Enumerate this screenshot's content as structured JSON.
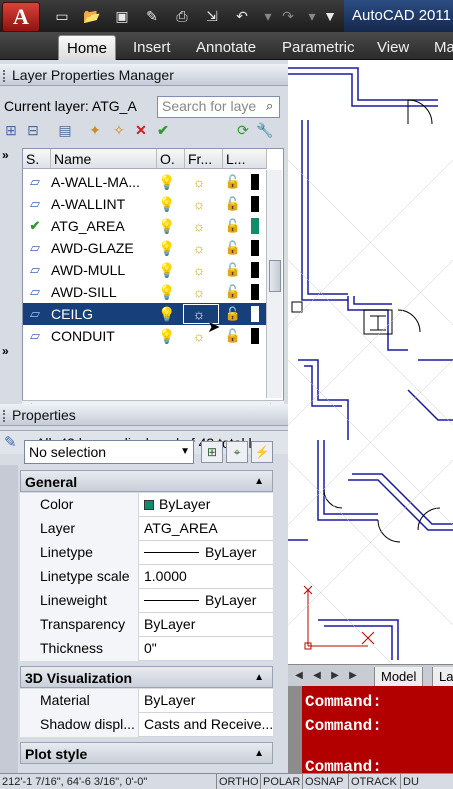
{
  "app": {
    "title": "AutoCAD 2011",
    "logo_letter": "A",
    "quick_access_icons": [
      "new-icon",
      "open-icon",
      "save-icon",
      "saveas-icon",
      "print-icon",
      "publish-icon",
      "undo-icon",
      "redo-icon",
      "dropdown-icon"
    ]
  },
  "ribbon": {
    "tabs": [
      {
        "label": "Home",
        "active": true
      },
      {
        "label": "Insert"
      },
      {
        "label": "Annotate"
      },
      {
        "label": "Parametric"
      },
      {
        "label": "View"
      },
      {
        "label": "Ma"
      }
    ]
  },
  "layer_manager": {
    "title": "Layer Properties Manager",
    "current_layer": "Current  layer: ATG_A",
    "search_placeholder": "Search for laye",
    "columns": [
      "S.",
      "Name",
      "O.",
      "Fr...",
      "L..."
    ],
    "rows": [
      {
        "name": "A-WALL-MA...",
        "status": "layer",
        "color": "black"
      },
      {
        "name": "A-WALLINT",
        "status": "layer",
        "color": "black"
      },
      {
        "name": "ATG_AREA",
        "status": "current",
        "color": "green"
      },
      {
        "name": "AWD-GLAZE",
        "status": "layer",
        "color": "black"
      },
      {
        "name": "AWD-MULL",
        "status": "layer",
        "color": "black"
      },
      {
        "name": "AWD-SILL",
        "status": "layer",
        "color": "black"
      },
      {
        "name": "CEILG",
        "status": "layer",
        "color": "white",
        "selected": true
      },
      {
        "name": "CONDUIT",
        "status": "layer",
        "color": "black"
      }
    ],
    "status_text": "All: 43 layers displayed of 43 total l"
  },
  "properties": {
    "title": "Properties",
    "selection": "No selection",
    "general_label": "General",
    "general": [
      {
        "key": "Color",
        "value": "ByLayer",
        "kind": "swatch",
        "swatch_color": "#0f8c6a"
      },
      {
        "key": "Layer",
        "value": "ATG_AREA"
      },
      {
        "key": "Linetype",
        "value": "ByLayer",
        "kind": "line"
      },
      {
        "key": "Linetype scale",
        "value": "1.0000"
      },
      {
        "key": "Lineweight",
        "value": "ByLayer",
        "kind": "line"
      },
      {
        "key": "Transparency",
        "value": "ByLayer"
      },
      {
        "key": "Thickness",
        "value": "0\""
      }
    ],
    "viz_label": "3D Visualization",
    "viz": [
      {
        "key": "Material",
        "value": "ByLayer"
      },
      {
        "key": "Shadow displ...",
        "value": "Casts and Receive..."
      }
    ],
    "plot_label": "Plot style"
  },
  "model_tabs": {
    "model": "Model",
    "layout": "La"
  },
  "command": {
    "lines": [
      "Command:",
      "Command:",
      "Command:"
    ]
  },
  "status_bar": {
    "coords": "212'-1 7/16\", 64'-6 3/16\", 0'-0\"",
    "toggles": [
      "ORTHO",
      "POLAR",
      "OSNAP",
      "OTRACK",
      "DU"
    ]
  },
  "colors": {
    "accent": "#173f7a",
    "command_bg": "#b20000",
    "layer_green": "#0f8c6a"
  }
}
